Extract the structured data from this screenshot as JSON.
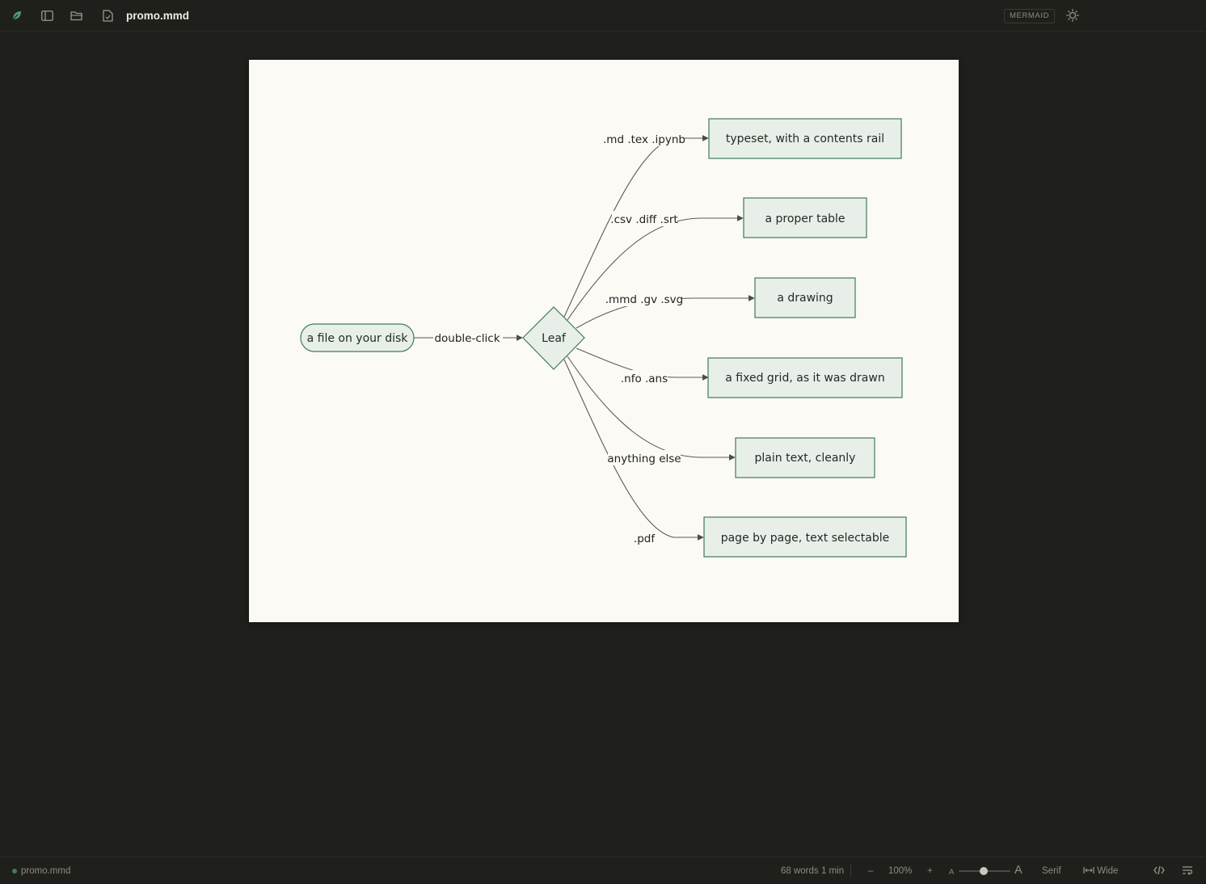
{
  "topbar": {
    "filename": "promo.mmd",
    "badge": "MERMAID",
    "icons": [
      "leaf-logo-icon",
      "sidebar-toggle-icon",
      "folder-open-icon",
      "file-check-icon",
      "sun-icon"
    ]
  },
  "diagram": {
    "type": "flowchart",
    "start": "a file on your disk",
    "start_edge": "double-click",
    "hub": "Leaf",
    "branches": [
      {
        "label": ".md .tex .ipynb",
        "target": "typeset, with a contents rail"
      },
      {
        "label": ".csv .diff .srt",
        "target": "a proper table"
      },
      {
        "label": ".mmd .gv .svg",
        "target": "a drawing"
      },
      {
        "label": ".nfo .ans",
        "target": "a fixed grid, as it was drawn"
      },
      {
        "label": "anything else",
        "target": "plain text, cleanly"
      },
      {
        "label": ".pdf",
        "target": "page by page, text selectable"
      }
    ],
    "colors": {
      "node_fill": "#e8efe8",
      "node_stroke": "#3f7b5a",
      "edge": "#4b4b48"
    }
  },
  "statusbar": {
    "filename": "promo.mmd",
    "words": "68 words",
    "reading_time": "1 min",
    "zoom_out": "–",
    "zoom": "100%",
    "zoom_in": "+",
    "font_small": "A",
    "font_large": "A",
    "font_size_level": 0.5,
    "font_family": "Serif",
    "width_mode": "Wide"
  }
}
